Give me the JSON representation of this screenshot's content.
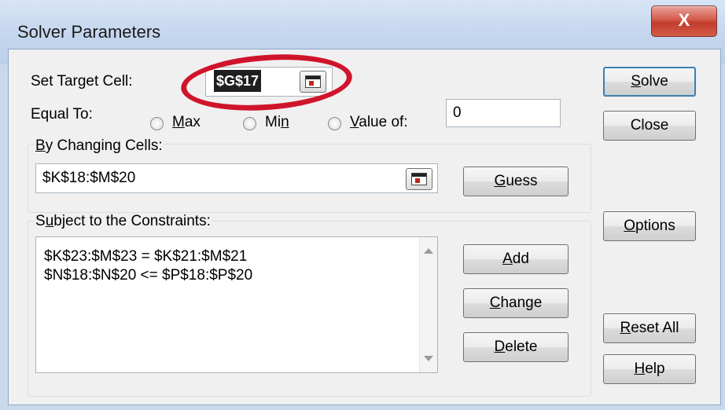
{
  "window": {
    "title": "Solver Parameters",
    "close_glyph": "X"
  },
  "target": {
    "label_pre": "Set Target Cell:",
    "value": "$G$17"
  },
  "equal_to": {
    "label": "Equal To:",
    "max": {
      "pre": "",
      "key": "M",
      "post": "ax"
    },
    "min": {
      "pre": "Mi",
      "key": "n",
      "post": ""
    },
    "value_of": {
      "pre": "",
      "key": "V",
      "post": "alue of:"
    },
    "selected": "min",
    "value_of_field": "0"
  },
  "changing": {
    "label": {
      "pre": "",
      "key": "B",
      "post": "y Changing Cells:"
    },
    "value": "$K$18:$M$20",
    "guess": {
      "pre": "",
      "key": "G",
      "post": "uess"
    }
  },
  "constraints": {
    "label": {
      "pre": "S",
      "key": "u",
      "post": "bject to the Constraints:"
    },
    "items": [
      "$K$23:$M$23 = $K$21:$M$21",
      "$N$18:$N$20 <= $P$18:$P$20"
    ],
    "add": {
      "pre": "",
      "key": "A",
      "post": "dd"
    },
    "change": {
      "pre": "",
      "key": "C",
      "post": "hange"
    },
    "delete": {
      "pre": "",
      "key": "D",
      "post": "elete"
    }
  },
  "side_buttons": {
    "solve": {
      "pre": "",
      "key": "S",
      "post": "olve"
    },
    "close": "Close",
    "options": {
      "pre": "",
      "key": "O",
      "post": "ptions"
    },
    "reset": {
      "pre": "",
      "key": "R",
      "post": "eset All"
    },
    "help": {
      "pre": "",
      "key": "H",
      "post": "elp"
    }
  },
  "annotation": {
    "color": "#d0142b",
    "shape": "ellipse around target cell"
  }
}
